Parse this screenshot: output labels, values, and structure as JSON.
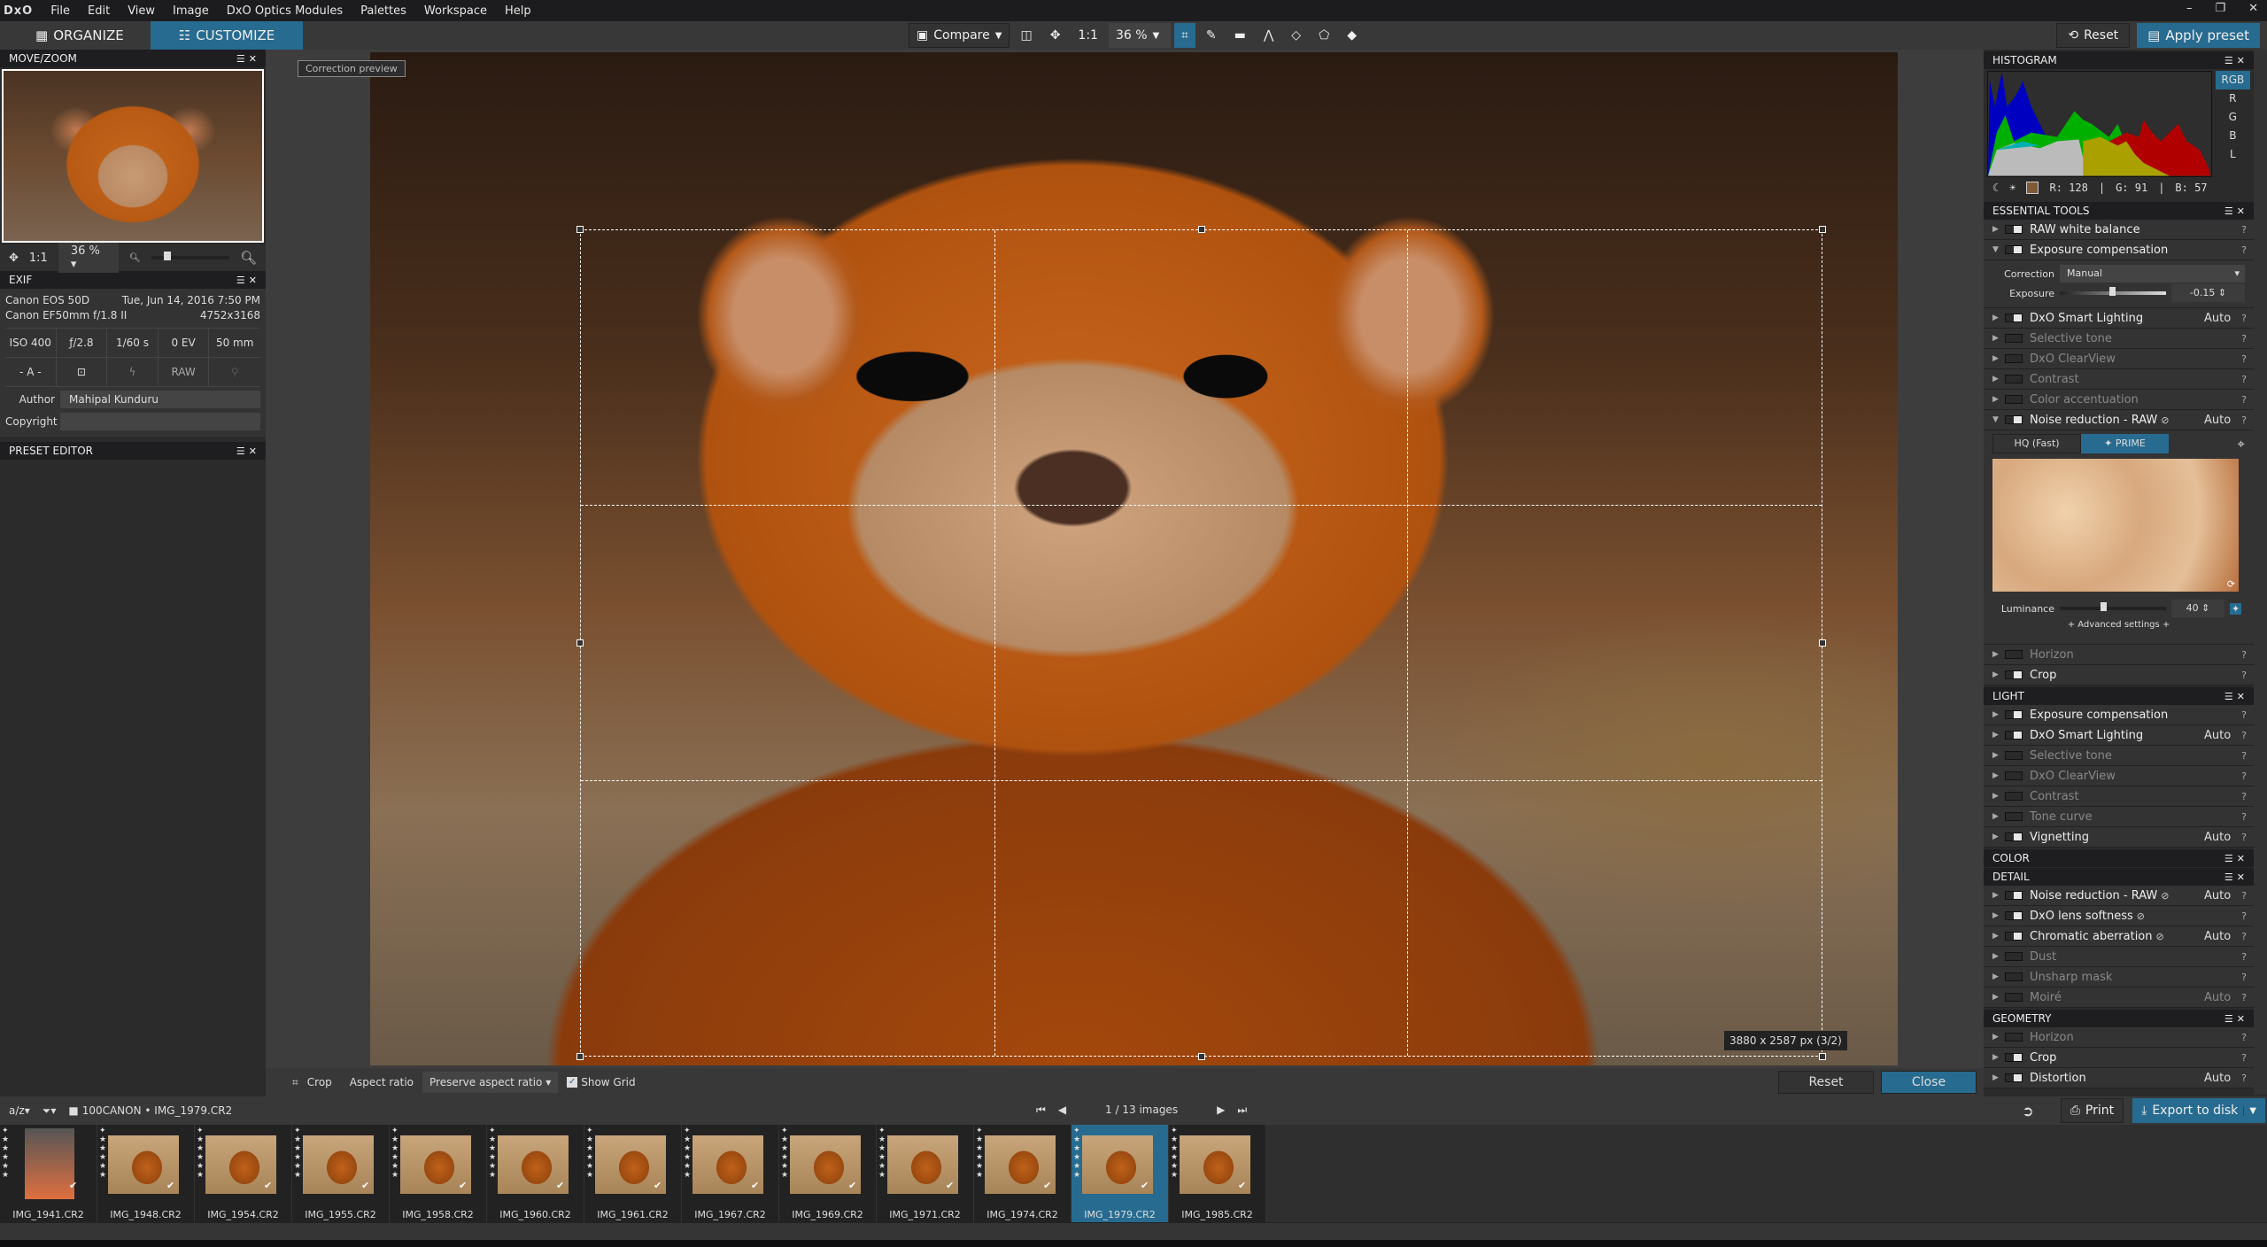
{
  "app": {
    "logo": "DxO",
    "menu": [
      "File",
      "Edit",
      "View",
      "Image",
      "DxO Optics Modules",
      "Palettes",
      "Workspace",
      "Help"
    ],
    "window_controls": [
      "–",
      "❐",
      "✕"
    ]
  },
  "toolbar": {
    "tabs": [
      {
        "label": "ORGANIZE",
        "active": false
      },
      {
        "label": "CUSTOMIZE",
        "active": true
      }
    ],
    "compare": "Compare",
    "one_to_one": "1:1",
    "zoom": "36 %",
    "reset": "Reset",
    "apply_preset": "Apply preset"
  },
  "left": {
    "move_zoom": {
      "title": "MOVE/ZOOM",
      "one_to_one": "1:1",
      "zoom": "36 %"
    },
    "exif": {
      "title": "EXIF",
      "camera": "Canon EOS 50D",
      "date": "Tue, Jun 14, 2016 7:50 PM",
      "lens": "Canon EF50mm f/1.8 II",
      "dimensions": "4752x3168",
      "iso": "ISO 400",
      "aperture": "ƒ/2.8",
      "shutter": "1/60 s",
      "ev": "0 EV",
      "focal": "50 mm",
      "mode": "- A -",
      "format": "RAW",
      "author_label": "Author",
      "author": "Mahipal Kunduru",
      "copyright_label": "Copyright",
      "copyright": ""
    },
    "preset_editor": {
      "title": "PRESET EDITOR"
    }
  },
  "viewer": {
    "correction_preview": "Correction preview",
    "crop_size": "3880 x 2587 px (3/2)"
  },
  "cropbar": {
    "crop": "Crop",
    "aspect_label": "Aspect ratio",
    "aspect_value": "Preserve aspect ratio",
    "show_grid": "Show Grid",
    "show_grid_checked": true,
    "reset": "Reset",
    "close": "Close"
  },
  "right": {
    "histogram": {
      "title": "HISTOGRAM",
      "channels": [
        "RGB",
        "R",
        "G",
        "B",
        "L"
      ],
      "active_channel": "RGB",
      "r": "R: 128",
      "g": "G:  91",
      "b": "B:  57",
      "swatch": "#805a39"
    },
    "essential": {
      "title": "ESSENTIAL TOOLS",
      "rows": [
        {
          "name": "RAW white balance",
          "on": true,
          "auto": ""
        },
        {
          "name": "Exposure compensation",
          "on": true,
          "auto": "",
          "expanded": true
        }
      ],
      "exposure": {
        "correction_label": "Correction",
        "correction_value": "Manual",
        "exposure_label": "Exposure",
        "exposure_value": "-0.15"
      },
      "rows2": [
        {
          "name": "DxO Smart Lighting",
          "on": true,
          "auto": "Auto"
        },
        {
          "name": "Selective tone",
          "on": false,
          "auto": ""
        },
        {
          "name": "DxO ClearView",
          "on": false,
          "auto": ""
        },
        {
          "name": "Contrast",
          "on": false,
          "auto": ""
        },
        {
          "name": "Color accentuation",
          "on": false,
          "auto": ""
        },
        {
          "name": "Noise reduction - RAW",
          "on": true,
          "auto": "Auto",
          "eye": true,
          "expanded": true
        }
      ],
      "noise": {
        "hq": "HQ (Fast)",
        "prime": "✦ PRIME",
        "luminance_label": "Luminance",
        "luminance_value": "40",
        "advanced": "+ Advanced settings +"
      },
      "rows3": [
        {
          "name": "Horizon",
          "on": false,
          "auto": ""
        },
        {
          "name": "Crop",
          "on": true,
          "auto": ""
        }
      ]
    },
    "light": {
      "title": "LIGHT",
      "rows": [
        {
          "name": "Exposure compensation",
          "on": true,
          "auto": ""
        },
        {
          "name": "DxO Smart Lighting",
          "on": true,
          "auto": "Auto"
        },
        {
          "name": "Selective tone",
          "on": false,
          "auto": ""
        },
        {
          "name": "DxO ClearView",
          "on": false,
          "auto": ""
        },
        {
          "name": "Contrast",
          "on": false,
          "auto": ""
        },
        {
          "name": "Tone curve",
          "on": false,
          "auto": ""
        },
        {
          "name": "Vignetting",
          "on": true,
          "auto": "Auto"
        }
      ]
    },
    "color": {
      "title": "COLOR"
    },
    "detail": {
      "title": "DETAIL",
      "rows": [
        {
          "name": "Noise reduction - RAW",
          "on": true,
          "auto": "Auto",
          "eye": true
        },
        {
          "name": "DxO lens softness",
          "on": true,
          "auto": "",
          "eye": true
        },
        {
          "name": "Chromatic aberration",
          "on": true,
          "auto": "Auto",
          "eye": true
        },
        {
          "name": "Dust",
          "on": false,
          "auto": ""
        },
        {
          "name": "Unsharp mask",
          "on": false,
          "auto": ""
        },
        {
          "name": "Moiré",
          "on": false,
          "auto": "Auto"
        }
      ]
    },
    "geometry": {
      "title": "GEOMETRY",
      "rows": [
        {
          "name": "Horizon",
          "on": false,
          "auto": ""
        },
        {
          "name": "Crop",
          "on": true,
          "auto": ""
        },
        {
          "name": "Distortion",
          "on": true,
          "auto": "Auto"
        }
      ]
    }
  },
  "filmbar": {
    "path": "100CANON • IMG_1979.CR2",
    "count": "1 / 13  images",
    "print": "Print",
    "export": "Export to disk"
  },
  "filmstrip": [
    {
      "name": "IMG_1941.CR2"
    },
    {
      "name": "IMG_1948.CR2"
    },
    {
      "name": "IMG_1954.CR2"
    },
    {
      "name": "IMG_1955.CR2"
    },
    {
      "name": "IMG_1958.CR2"
    },
    {
      "name": "IMG_1960.CR2"
    },
    {
      "name": "IMG_1961.CR2"
    },
    {
      "name": "IMG_1967.CR2"
    },
    {
      "name": "IMG_1969.CR2"
    },
    {
      "name": "IMG_1971.CR2"
    },
    {
      "name": "IMG_1974.CR2"
    },
    {
      "name": "IMG_1979.CR2",
      "selected": true
    },
    {
      "name": "IMG_1985.CR2"
    }
  ],
  "colors": {
    "accent": "#276b90",
    "panel": "#333333",
    "header": "#1e1e20"
  }
}
